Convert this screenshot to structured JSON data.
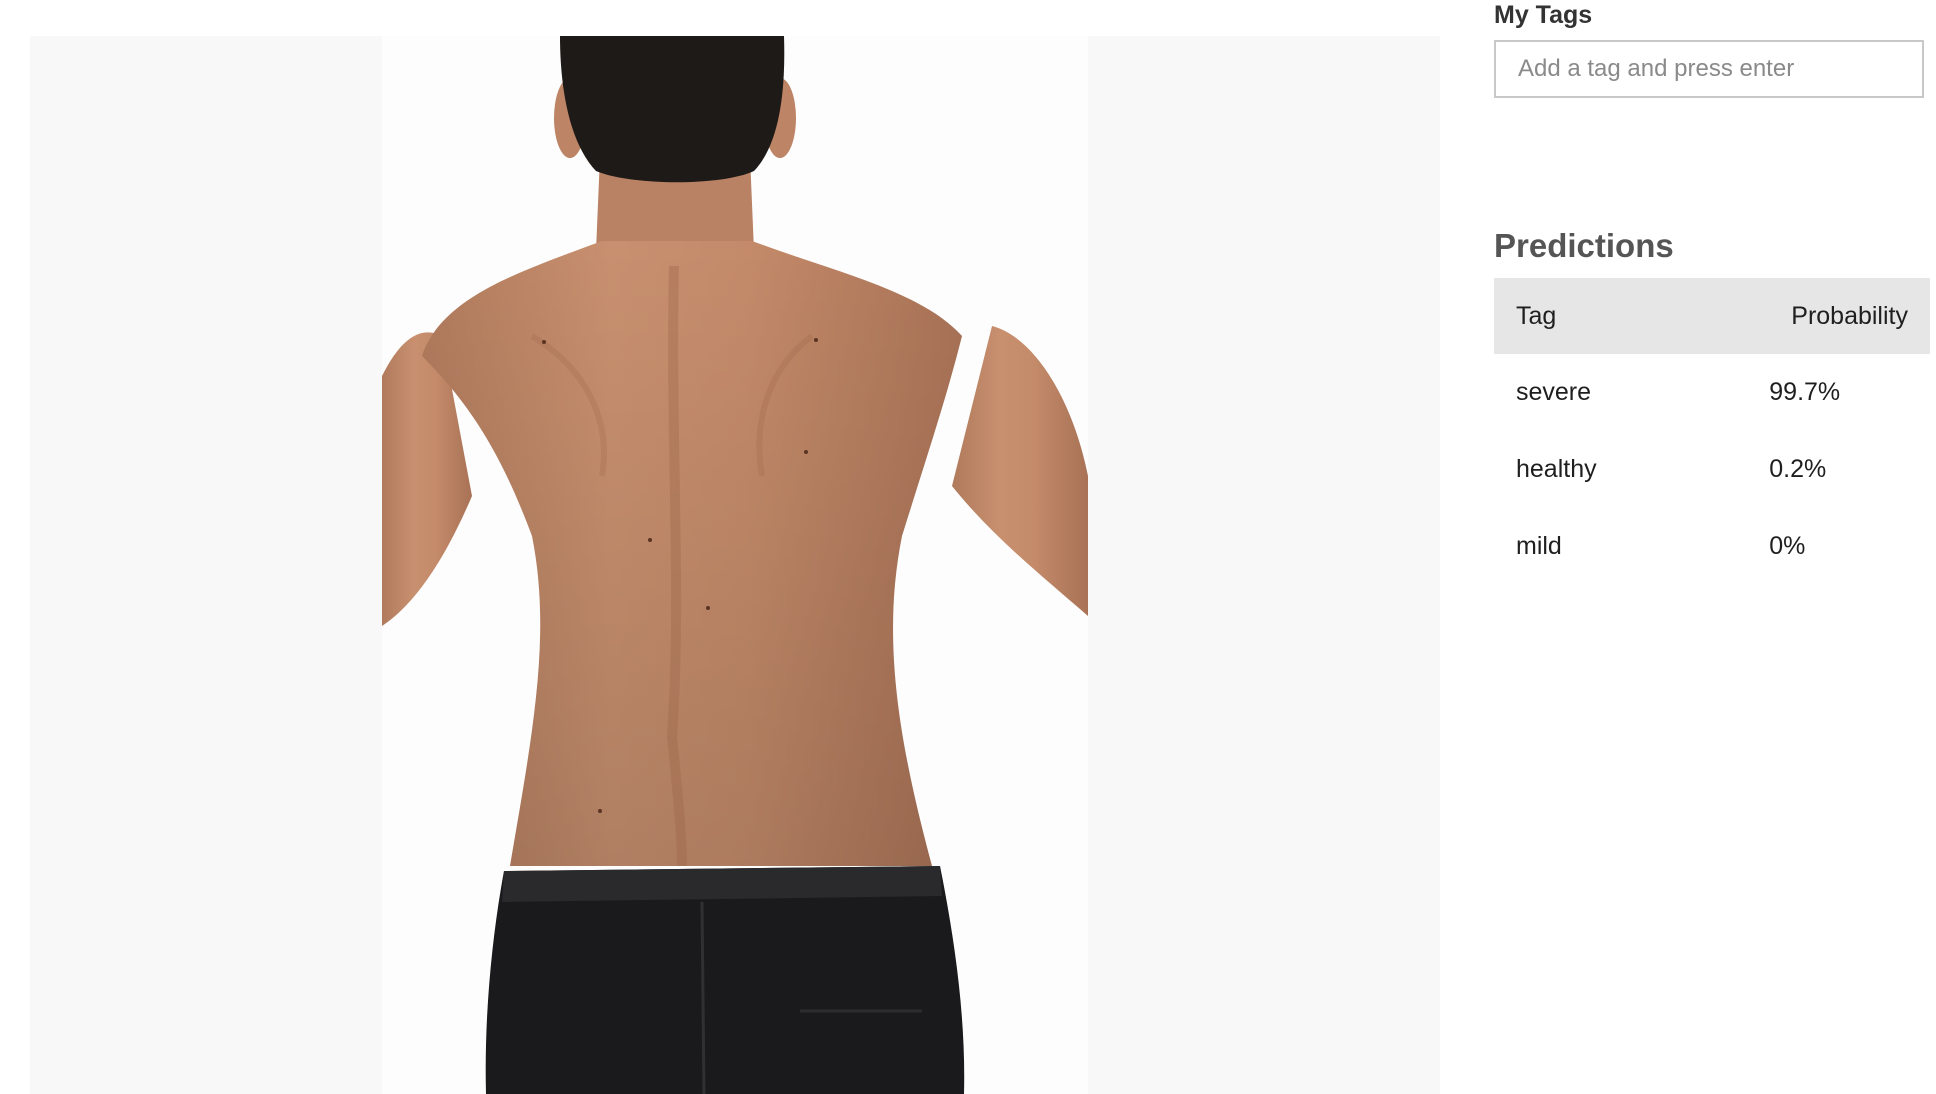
{
  "tags_panel": {
    "heading": "My Tags",
    "input_placeholder": "Add a tag and press enter",
    "input_value": ""
  },
  "predictions": {
    "heading": "Predictions",
    "columns": {
      "tag": "Tag",
      "probability": "Probability"
    },
    "rows": [
      {
        "tag": "severe",
        "probability": "99.7%"
      },
      {
        "tag": "healthy",
        "probability": "0.2%"
      },
      {
        "tag": "mild",
        "probability": "0%"
      }
    ]
  },
  "colors": {
    "header_bg": "#e6e6e6",
    "viewer_bg": "#f8f8f8",
    "heading_text": "#555555"
  }
}
